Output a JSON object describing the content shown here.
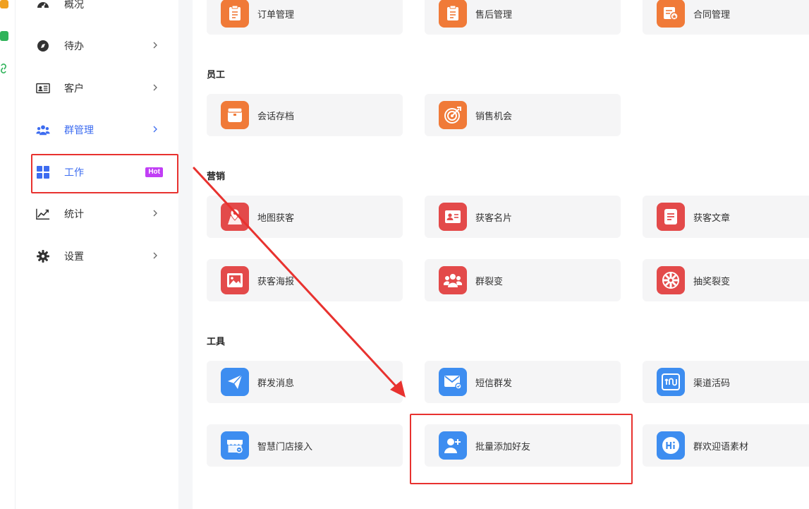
{
  "colors": {
    "accent": "#3d6cf0",
    "orange": "#f07a38",
    "red": "#e34a4a",
    "blue": "#3d8df0",
    "hot": "#c13ef5",
    "highlight": "#e8322f"
  },
  "sidebar": {
    "items": [
      {
        "label": "概况",
        "icon": "dashboard-icon"
      },
      {
        "label": "待办",
        "icon": "compass-icon"
      },
      {
        "label": "客户",
        "icon": "id-card-icon"
      },
      {
        "label": "群管理",
        "icon": "group-icon"
      },
      {
        "label": "工作",
        "icon": "grid-icon",
        "badge": "Hot"
      },
      {
        "label": "统计",
        "icon": "chart-icon"
      },
      {
        "label": "设置",
        "icon": "gear-icon"
      }
    ]
  },
  "sections": {
    "employee": "员工",
    "marketing": "营销",
    "tools": "工具"
  },
  "cards": {
    "order": "订单管理",
    "aftersale": "售后管理",
    "contract": "合同管理",
    "session": "会话存档",
    "opportunity": "销售机会",
    "map": "地图获客",
    "bizcard": "获客名片",
    "article": "获客文章",
    "poster": "获客海报",
    "fission": "群裂变",
    "lottery": "抽奖裂变",
    "mass_msg": "群发消息",
    "sms": "短信群发",
    "channel": "渠道活码",
    "store": "智慧门店接入",
    "batch_add": "批量添加好友",
    "welcome": "群欢迎语素材"
  }
}
